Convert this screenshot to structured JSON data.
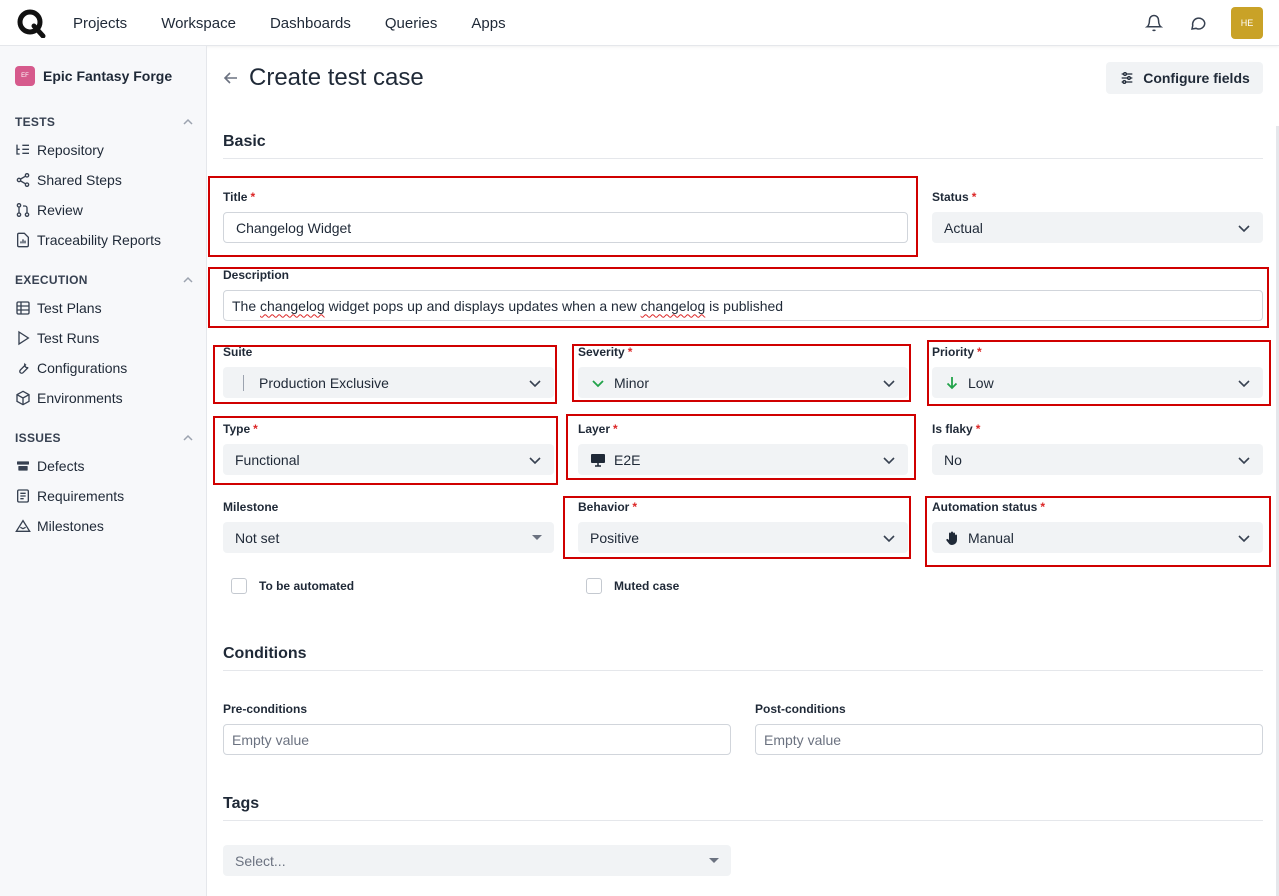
{
  "nav": {
    "links": [
      "Projects",
      "Workspace",
      "Dashboards",
      "Queries",
      "Apps"
    ],
    "avatar_initials": "HE"
  },
  "sidebar": {
    "project_badge": "EF",
    "project_name": "Epic Fantasy Forge",
    "tests_title": "TESTS",
    "tests_items": [
      "Repository",
      "Shared Steps",
      "Review",
      "Traceability Reports"
    ],
    "execution_title": "EXECUTION",
    "execution_items": [
      "Test Plans",
      "Test Runs",
      "Configurations",
      "Environments"
    ],
    "issues_title": "ISSUES",
    "issues_items": [
      "Defects",
      "Requirements",
      "Milestones"
    ]
  },
  "header": {
    "title": "Create test case",
    "configure_label": "Configure fields"
  },
  "basic": {
    "section_title": "Basic",
    "title_label": "Title",
    "title_value": "Changelog Widget",
    "status_label": "Status",
    "status_value": "Actual",
    "description_label": "Description",
    "description_pre": "The ",
    "description_w1": "changelog",
    "description_mid": " widget pops up and displays updates when a new ",
    "description_w2": "changelog",
    "description_post": " is published",
    "suite_label": "Suite",
    "suite_value": "Production Exclusive",
    "severity_label": "Severity",
    "severity_value": "Minor",
    "priority_label": "Priority",
    "priority_value": "Low",
    "type_label": "Type",
    "type_value": "Functional",
    "layer_label": "Layer",
    "layer_value": "E2E",
    "flaky_label": "Is flaky",
    "flaky_value": "No",
    "milestone_label": "Milestone",
    "milestone_value": "Not set",
    "behavior_label": "Behavior",
    "behavior_value": "Positive",
    "automation_label": "Automation status",
    "automation_value": "Manual",
    "to_be_automated_label": "To be automated",
    "muted_label": "Muted case",
    "required_mark": "*"
  },
  "conditions": {
    "section_title": "Conditions",
    "pre_label": "Pre-conditions",
    "pre_placeholder": "Empty value",
    "post_label": "Post-conditions",
    "post_placeholder": "Empty value"
  },
  "tags": {
    "section_title": "Tags",
    "placeholder": "Select..."
  },
  "colors": {
    "highlight": "#d00000",
    "required": "#dc2626",
    "accent_green": "#22a34a",
    "avatar": "#c9a227",
    "project_badge": "#d65a8c"
  }
}
